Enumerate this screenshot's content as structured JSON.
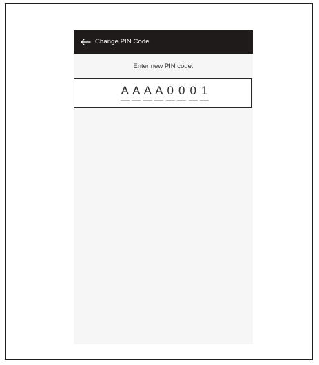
{
  "appbar": {
    "title": "Change PIN Code",
    "back_icon": "arrow-left-icon"
  },
  "prompt": "Enter new PIN code.",
  "pin": {
    "value": "AAAA0001",
    "chars": [
      "A",
      "A",
      "A",
      "A",
      "0",
      "0",
      "0",
      "1"
    ]
  },
  "colors": {
    "appbar_bg": "#1f1b1b",
    "screen_bg": "#f6f6f6",
    "text": "#333333"
  }
}
